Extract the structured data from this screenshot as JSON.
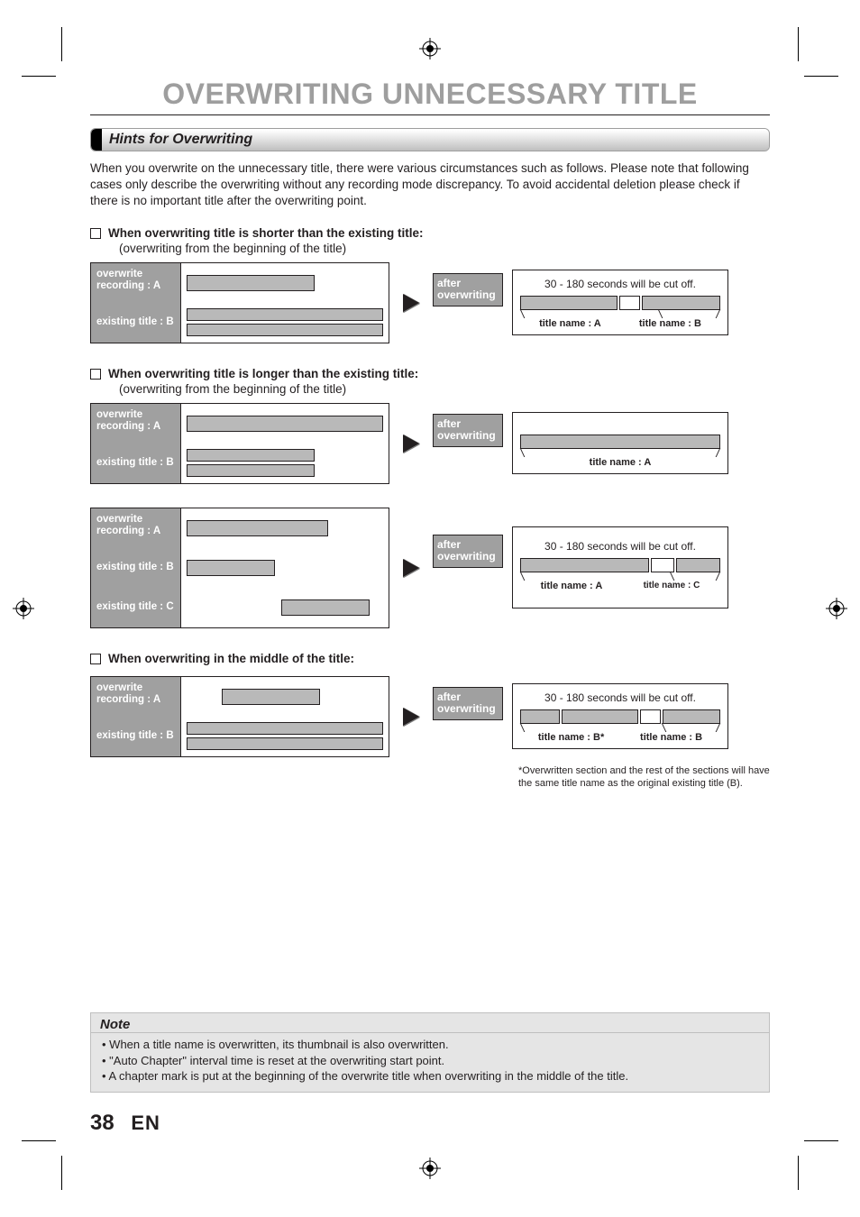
{
  "page": {
    "title": "OVERWRITING UNNECESSARY TITLE",
    "section": "Hints for Overwriting",
    "intro": "When you overwrite on the unnecessary title, there were various circumstances such as follows.  Please note that following cases only describe the overwriting without any recording mode discrepancy.  To avoid accidental deletion please check if there is no important title after the overwriting point.",
    "pagenum": "38",
    "lang": "EN"
  },
  "labels": {
    "overwrite_a": "overwrite recording : A",
    "existing_b": "existing title : B",
    "existing_c": "existing title : C",
    "after": "after overwriting",
    "cutoff": "30 - 180 seconds will be cut off.",
    "name_a": "title name : A",
    "name_b": "title name : B",
    "name_c": "title name : C",
    "name_b_star": "title name : B*"
  },
  "cases": {
    "c1": {
      "heading": "When overwriting title is shorter than the existing title:",
      "sub": "(overwriting from the beginning of the title)"
    },
    "c2": {
      "heading": "When overwriting title is longer than the existing title:",
      "sub": "(overwriting from the beginning of the title)"
    },
    "c3": {
      "heading": "When overwriting in the middle of the title:"
    }
  },
  "footnote": "*Overwritten section and the rest of the sections will have the same title name as the original existing title (B).",
  "note": {
    "title": "Note",
    "items": [
      "When a title name is overwritten, its thumbnail is also overwritten.",
      "\"Auto Chapter\" interval time is reset at the overwriting start point.",
      "A chapter mark is put at the beginning of the overwrite title when overwriting in the middle of the title."
    ]
  }
}
